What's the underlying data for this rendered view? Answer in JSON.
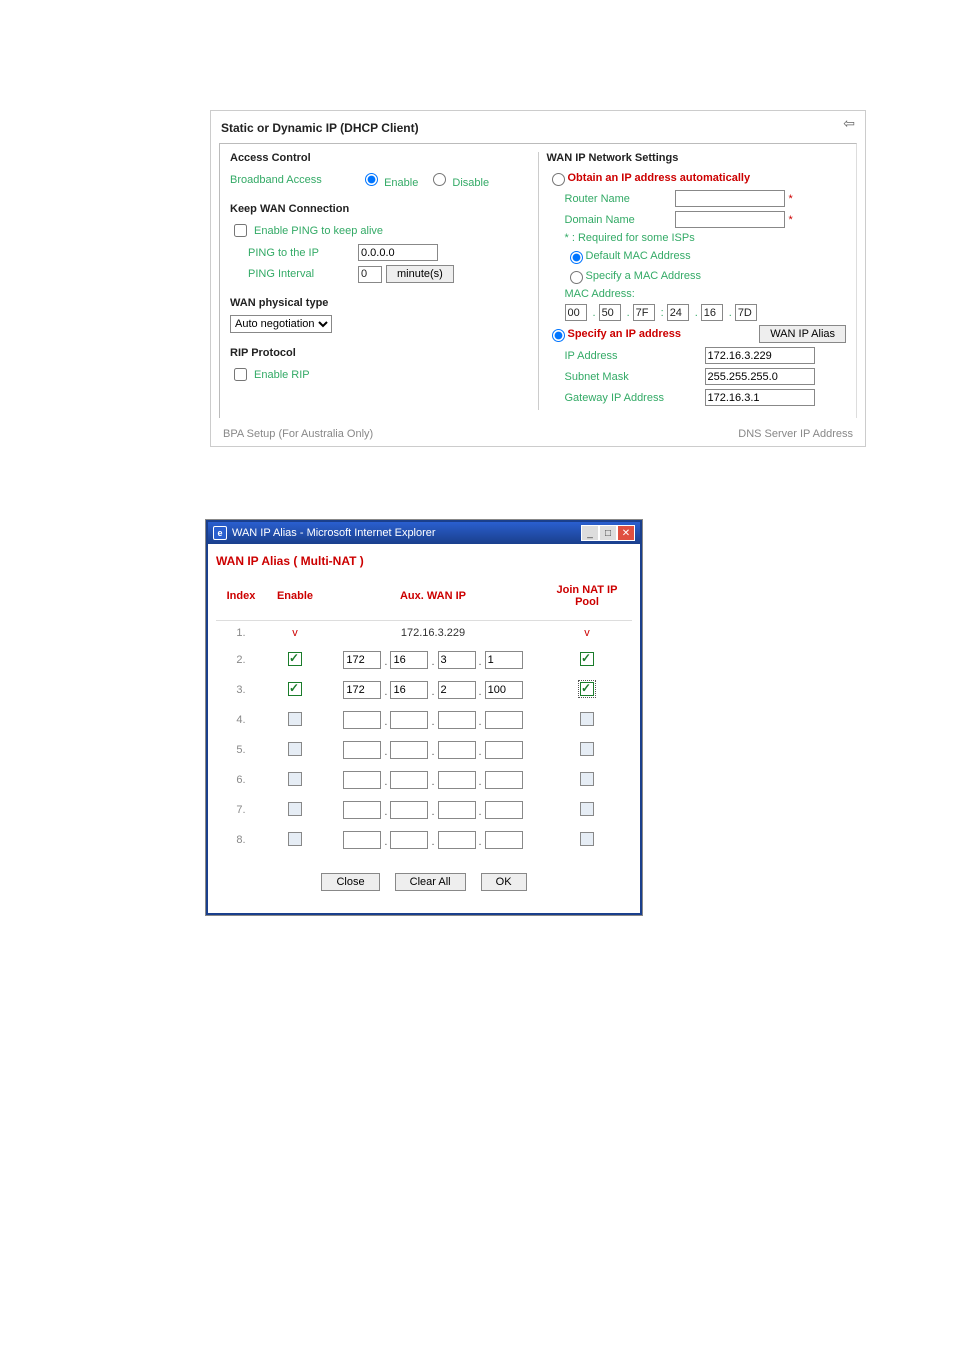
{
  "main": {
    "title": "Static or Dynamic IP (DHCP Client)",
    "back_arrow": "⇦",
    "access_control": {
      "heading": "Access Control",
      "row_label": "Broadband Access",
      "enable": "Enable",
      "disable": "Disable"
    },
    "keep_wan": {
      "heading": "Keep WAN Connection",
      "enable_ping_label": "Enable PING to keep alive",
      "ping_to_ip_label": "PING to the IP",
      "ping_to_ip_value": "0.0.0.0",
      "ping_interval_label": "PING Interval",
      "ping_interval_value": "0",
      "minutes_label": "minute(s)"
    },
    "wan_phys": {
      "heading": "WAN physical type",
      "select_value": "Auto negotiation"
    },
    "rip": {
      "heading": "RIP Protocol",
      "enable_label": "Enable RIP"
    },
    "wan_ip": {
      "heading": "WAN IP Network Settings",
      "obtain_auto": "Obtain an IP address automatically",
      "router_name_label": "Router Name",
      "router_name_value": "",
      "domain_name_label": "Domain Name",
      "domain_name_value": "",
      "required_note": "*  : Required for some ISPs",
      "default_mac_label": "Default MAC Address",
      "specify_mac_label": "Specify a MAC Address",
      "mac_address_label": "MAC Address:",
      "mac": [
        "00",
        "50",
        "7F",
        "24",
        "16",
        "7D"
      ],
      "specify_ip_label": "Specify an IP address",
      "wan_ip_alias_btn": "WAN IP Alias",
      "ip_address_label": "IP Address",
      "ip_address_value": "172.16.3.229",
      "subnet_label": "Subnet Mask",
      "subnet_value": "255.255.255.0",
      "gateway_label": "Gateway IP Address",
      "gateway_value": "172.16.3.1"
    },
    "footer": {
      "left": "BPA Setup (For Australia Only)",
      "right": "DNS Server IP Address"
    }
  },
  "popup": {
    "window_title": "WAN IP Alias - Microsoft Internet Explorer",
    "subtitle": "WAN IP Alias ( Multi-NAT )",
    "cols": {
      "index": "Index",
      "enable": "Enable",
      "aux": "Aux. WAN IP",
      "join": "Join NAT IP Pool"
    },
    "rows": [
      {
        "i": "1.",
        "enable": "v",
        "ip_text": "172.16.3.229",
        "ip": null,
        "join": "v",
        "join_checked": null
      },
      {
        "i": "2.",
        "enable": null,
        "enable_checked": true,
        "ip": [
          "172",
          "16",
          "3",
          "1"
        ],
        "join_checked": true
      },
      {
        "i": "3.",
        "enable": null,
        "enable_checked": true,
        "ip": [
          "172",
          "16",
          "2",
          "100"
        ],
        "join_checked": true,
        "join_hl": true
      },
      {
        "i": "4.",
        "enable": null,
        "enable_checked": false,
        "ip": [
          "",
          "",
          "",
          ""
        ],
        "join_checked": false
      },
      {
        "i": "5.",
        "enable": null,
        "enable_checked": false,
        "ip": [
          "",
          "",
          "",
          ""
        ],
        "join_checked": false
      },
      {
        "i": "6.",
        "enable": null,
        "enable_checked": false,
        "ip": [
          "",
          "",
          "",
          ""
        ],
        "join_checked": false
      },
      {
        "i": "7.",
        "enable": null,
        "enable_checked": false,
        "ip": [
          "",
          "",
          "",
          ""
        ],
        "join_checked": false
      },
      {
        "i": "8.",
        "enable": null,
        "enable_checked": false,
        "ip": [
          "",
          "",
          "",
          ""
        ],
        "join_checked": false
      }
    ],
    "buttons": {
      "close": "Close",
      "clear": "Clear All",
      "ok": "OK"
    }
  }
}
